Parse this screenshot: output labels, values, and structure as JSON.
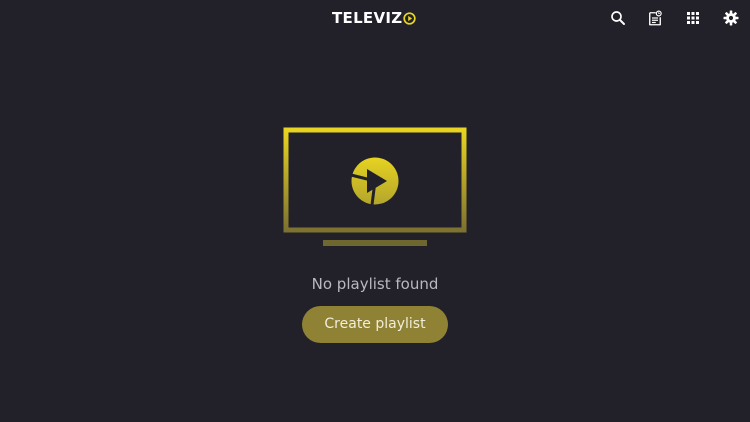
{
  "header": {
    "logo_text": "TELEVIZ",
    "actions": [
      {
        "id": "search",
        "icon": "search-icon"
      },
      {
        "id": "epg",
        "icon": "tv-guide-icon"
      },
      {
        "id": "apps",
        "icon": "grid-icon"
      },
      {
        "id": "settings",
        "icon": "gear-icon"
      }
    ]
  },
  "empty_state": {
    "illustration_icon": "tv-play-icon",
    "message": "No playlist found",
    "button_label": "Create playlist"
  },
  "colors": {
    "background": "#222129",
    "accent": "#e8d421",
    "button": "#8f8235",
    "text_muted": "#b9b8c0"
  }
}
